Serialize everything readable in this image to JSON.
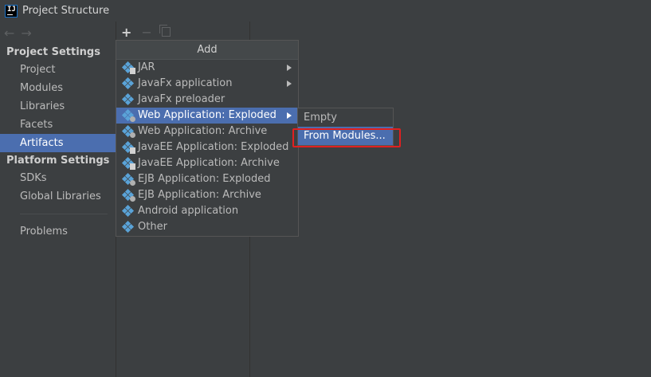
{
  "window": {
    "title": "Project Structure",
    "app_icon": "IJ"
  },
  "nav": {
    "back_icon": "←",
    "forward_icon": "→"
  },
  "sidebar": {
    "project_settings_header": "Project Settings",
    "project_items": [
      "Project",
      "Modules",
      "Libraries",
      "Facets",
      "Artifacts"
    ],
    "selected_item": "Artifacts",
    "platform_settings_header": "Platform Settings",
    "platform_items": [
      "SDKs",
      "Global Libraries"
    ],
    "problems": "Problems"
  },
  "toolbar": {
    "add_icon": "+",
    "remove_icon": "−"
  },
  "popup": {
    "header": "Add",
    "items": [
      {
        "label": "JAR",
        "submenu": true,
        "badge": "jar"
      },
      {
        "label": "JavaFx application",
        "submenu": true,
        "badge": ""
      },
      {
        "label": "JavaFx preloader",
        "submenu": false,
        "badge": ""
      },
      {
        "label": "Web Application: Exploded",
        "submenu": true,
        "badge": "web",
        "active": true
      },
      {
        "label": "Web Application: Archive",
        "submenu": false,
        "badge": "web"
      },
      {
        "label": "JavaEE Application: Exploded",
        "submenu": false,
        "badge": "jar"
      },
      {
        "label": "JavaEE Application: Archive",
        "submenu": false,
        "badge": "jar"
      },
      {
        "label": "EJB Application: Exploded",
        "submenu": false,
        "badge": "web"
      },
      {
        "label": "EJB Application: Archive",
        "submenu": false,
        "badge": "web"
      },
      {
        "label": "Android application",
        "submenu": false,
        "badge": ""
      },
      {
        "label": "Other",
        "submenu": false,
        "badge": ""
      }
    ]
  },
  "submenu": {
    "items": [
      "Empty",
      "From Modules..."
    ],
    "active_item": "From Modules..."
  },
  "colors": {
    "selection": "#4b6eaf",
    "highlight_border": "#e02020",
    "icon": "#5aa3d8"
  }
}
